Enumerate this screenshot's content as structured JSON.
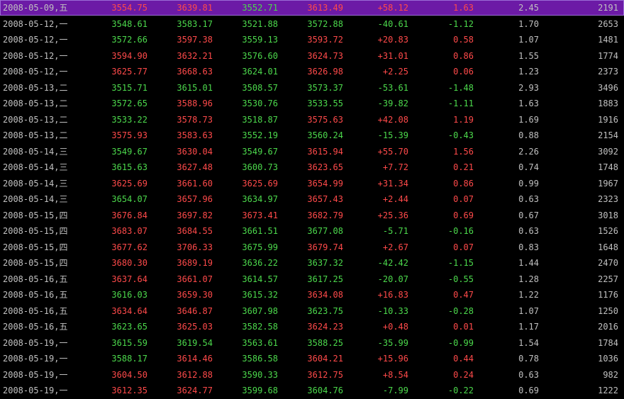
{
  "colors": {
    "up": "#ff4a4a",
    "down": "#4cd94c",
    "neutral": "#c0c0c0",
    "background": "#000000",
    "selected_row": "#6c1aa6"
  },
  "selected_index": 0,
  "rows": [
    {
      "date": "2008-05-09,五",
      "open": "3554.75",
      "high": "3639.81",
      "low": "3552.71",
      "close": "3613.49",
      "change": "+58.12",
      "pct": "1.63",
      "amplitude": "2.45",
      "volume": "2191",
      "oc": "up",
      "hc": "up",
      "lc": "down",
      "cc": "up",
      "dir": "up"
    },
    {
      "date": "2008-05-12,一",
      "open": "3548.61",
      "high": "3583.17",
      "low": "3521.88",
      "close": "3572.88",
      "change": "-40.61",
      "pct": "-1.12",
      "amplitude": "1.70",
      "volume": "2653",
      "oc": "down",
      "hc": "down",
      "lc": "down",
      "cc": "down",
      "dir": "down"
    },
    {
      "date": "2008-05-12,一",
      "open": "3572.66",
      "high": "3597.38",
      "low": "3559.13",
      "close": "3593.72",
      "change": "+20.83",
      "pct": "0.58",
      "amplitude": "1.07",
      "volume": "1481",
      "oc": "down",
      "hc": "up",
      "lc": "down",
      "cc": "up",
      "dir": "up"
    },
    {
      "date": "2008-05-12,一",
      "open": "3594.90",
      "high": "3632.21",
      "low": "3576.60",
      "close": "3624.73",
      "change": "+31.01",
      "pct": "0.86",
      "amplitude": "1.55",
      "volume": "1774",
      "oc": "up",
      "hc": "up",
      "lc": "down",
      "cc": "up",
      "dir": "up"
    },
    {
      "date": "2008-05-12,一",
      "open": "3625.77",
      "high": "3668.63",
      "low": "3624.01",
      "close": "3626.98",
      "change": "+2.25",
      "pct": "0.06",
      "amplitude": "1.23",
      "volume": "2373",
      "oc": "up",
      "hc": "up",
      "lc": "down",
      "cc": "up",
      "dir": "up"
    },
    {
      "date": "2008-05-13,二",
      "open": "3515.71",
      "high": "3615.01",
      "low": "3508.57",
      "close": "3573.37",
      "change": "-53.61",
      "pct": "-1.48",
      "amplitude": "2.93",
      "volume": "3496",
      "oc": "down",
      "hc": "down",
      "lc": "down",
      "cc": "down",
      "dir": "down"
    },
    {
      "date": "2008-05-13,二",
      "open": "3572.65",
      "high": "3588.96",
      "low": "3530.76",
      "close": "3533.55",
      "change": "-39.82",
      "pct": "-1.11",
      "amplitude": "1.63",
      "volume": "1883",
      "oc": "down",
      "hc": "up",
      "lc": "down",
      "cc": "down",
      "dir": "down"
    },
    {
      "date": "2008-05-13,二",
      "open": "3533.22",
      "high": "3578.73",
      "low": "3518.87",
      "close": "3575.63",
      "change": "+42.08",
      "pct": "1.19",
      "amplitude": "1.69",
      "volume": "1916",
      "oc": "down",
      "hc": "up",
      "lc": "down",
      "cc": "up",
      "dir": "up"
    },
    {
      "date": "2008-05-13,二",
      "open": "3575.93",
      "high": "3583.63",
      "low": "3552.19",
      "close": "3560.24",
      "change": "-15.39",
      "pct": "-0.43",
      "amplitude": "0.88",
      "volume": "2154",
      "oc": "up",
      "hc": "up",
      "lc": "down",
      "cc": "down",
      "dir": "down"
    },
    {
      "date": "2008-05-14,三",
      "open": "3549.67",
      "high": "3630.04",
      "low": "3549.67",
      "close": "3615.94",
      "change": "+55.70",
      "pct": "1.56",
      "amplitude": "2.26",
      "volume": "3092",
      "oc": "down",
      "hc": "up",
      "lc": "down",
      "cc": "up",
      "dir": "up"
    },
    {
      "date": "2008-05-14,三",
      "open": "3615.63",
      "high": "3627.48",
      "low": "3600.73",
      "close": "3623.65",
      "change": "+7.72",
      "pct": "0.21",
      "amplitude": "0.74",
      "volume": "1748",
      "oc": "down",
      "hc": "up",
      "lc": "down",
      "cc": "up",
      "dir": "up"
    },
    {
      "date": "2008-05-14,三",
      "open": "3625.69",
      "high": "3661.60",
      "low": "3625.69",
      "close": "3654.99",
      "change": "+31.34",
      "pct": "0.86",
      "amplitude": "0.99",
      "volume": "1967",
      "oc": "up",
      "hc": "up",
      "lc": "up",
      "cc": "up",
      "dir": "up"
    },
    {
      "date": "2008-05-14,三",
      "open": "3654.07",
      "high": "3657.96",
      "low": "3634.97",
      "close": "3657.43",
      "change": "+2.44",
      "pct": "0.07",
      "amplitude": "0.63",
      "volume": "2323",
      "oc": "down",
      "hc": "up",
      "lc": "down",
      "cc": "up",
      "dir": "up"
    },
    {
      "date": "2008-05-15,四",
      "open": "3676.84",
      "high": "3697.82",
      "low": "3673.41",
      "close": "3682.79",
      "change": "+25.36",
      "pct": "0.69",
      "amplitude": "0.67",
      "volume": "3018",
      "oc": "up",
      "hc": "up",
      "lc": "up",
      "cc": "up",
      "dir": "up"
    },
    {
      "date": "2008-05-15,四",
      "open": "3683.07",
      "high": "3684.55",
      "low": "3661.51",
      "close": "3677.08",
      "change": "-5.71",
      "pct": "-0.16",
      "amplitude": "0.63",
      "volume": "1526",
      "oc": "up",
      "hc": "up",
      "lc": "down",
      "cc": "down",
      "dir": "down"
    },
    {
      "date": "2008-05-15,四",
      "open": "3677.62",
      "high": "3706.33",
      "low": "3675.99",
      "close": "3679.74",
      "change": "+2.67",
      "pct": "0.07",
      "amplitude": "0.83",
      "volume": "1648",
      "oc": "up",
      "hc": "up",
      "lc": "down",
      "cc": "up",
      "dir": "up"
    },
    {
      "date": "2008-05-15,四",
      "open": "3680.30",
      "high": "3689.19",
      "low": "3636.22",
      "close": "3637.32",
      "change": "-42.42",
      "pct": "-1.15",
      "amplitude": "1.44",
      "volume": "2470",
      "oc": "up",
      "hc": "up",
      "lc": "down",
      "cc": "down",
      "dir": "down"
    },
    {
      "date": "2008-05-16,五",
      "open": "3637.64",
      "high": "3661.07",
      "low": "3614.57",
      "close": "3617.25",
      "change": "-20.07",
      "pct": "-0.55",
      "amplitude": "1.28",
      "volume": "2257",
      "oc": "up",
      "hc": "up",
      "lc": "down",
      "cc": "down",
      "dir": "down"
    },
    {
      "date": "2008-05-16,五",
      "open": "3616.03",
      "high": "3659.30",
      "low": "3615.32",
      "close": "3634.08",
      "change": "+16.83",
      "pct": "0.47",
      "amplitude": "1.22",
      "volume": "1176",
      "oc": "down",
      "hc": "up",
      "lc": "down",
      "cc": "up",
      "dir": "up"
    },
    {
      "date": "2008-05-16,五",
      "open": "3634.64",
      "high": "3646.87",
      "low": "3607.98",
      "close": "3623.75",
      "change": "-10.33",
      "pct": "-0.28",
      "amplitude": "1.07",
      "volume": "1250",
      "oc": "up",
      "hc": "up",
      "lc": "down",
      "cc": "down",
      "dir": "down"
    },
    {
      "date": "2008-05-16,五",
      "open": "3623.65",
      "high": "3625.03",
      "low": "3582.58",
      "close": "3624.23",
      "change": "+0.48",
      "pct": "0.01",
      "amplitude": "1.17",
      "volume": "2016",
      "oc": "down",
      "hc": "up",
      "lc": "down",
      "cc": "up",
      "dir": "up"
    },
    {
      "date": "2008-05-19,一",
      "open": "3615.59",
      "high": "3619.54",
      "low": "3563.61",
      "close": "3588.25",
      "change": "-35.99",
      "pct": "-0.99",
      "amplitude": "1.54",
      "volume": "1784",
      "oc": "down",
      "hc": "down",
      "lc": "down",
      "cc": "down",
      "dir": "down"
    },
    {
      "date": "2008-05-19,一",
      "open": "3588.17",
      "high": "3614.46",
      "low": "3586.58",
      "close": "3604.21",
      "change": "+15.96",
      "pct": "0.44",
      "amplitude": "0.78",
      "volume": "1036",
      "oc": "down",
      "hc": "up",
      "lc": "down",
      "cc": "up",
      "dir": "up"
    },
    {
      "date": "2008-05-19,一",
      "open": "3604.50",
      "high": "3612.88",
      "low": "3590.33",
      "close": "3612.75",
      "change": "+8.54",
      "pct": "0.24",
      "amplitude": "0.63",
      "volume": "982",
      "oc": "up",
      "hc": "up",
      "lc": "down",
      "cc": "up",
      "dir": "up"
    },
    {
      "date": "2008-05-19,一",
      "open": "3612.35",
      "high": "3624.77",
      "low": "3599.68",
      "close": "3604.76",
      "change": "-7.99",
      "pct": "-0.22",
      "amplitude": "0.69",
      "volume": "1222",
      "oc": "up",
      "hc": "up",
      "lc": "down",
      "cc": "down",
      "dir": "down"
    }
  ]
}
